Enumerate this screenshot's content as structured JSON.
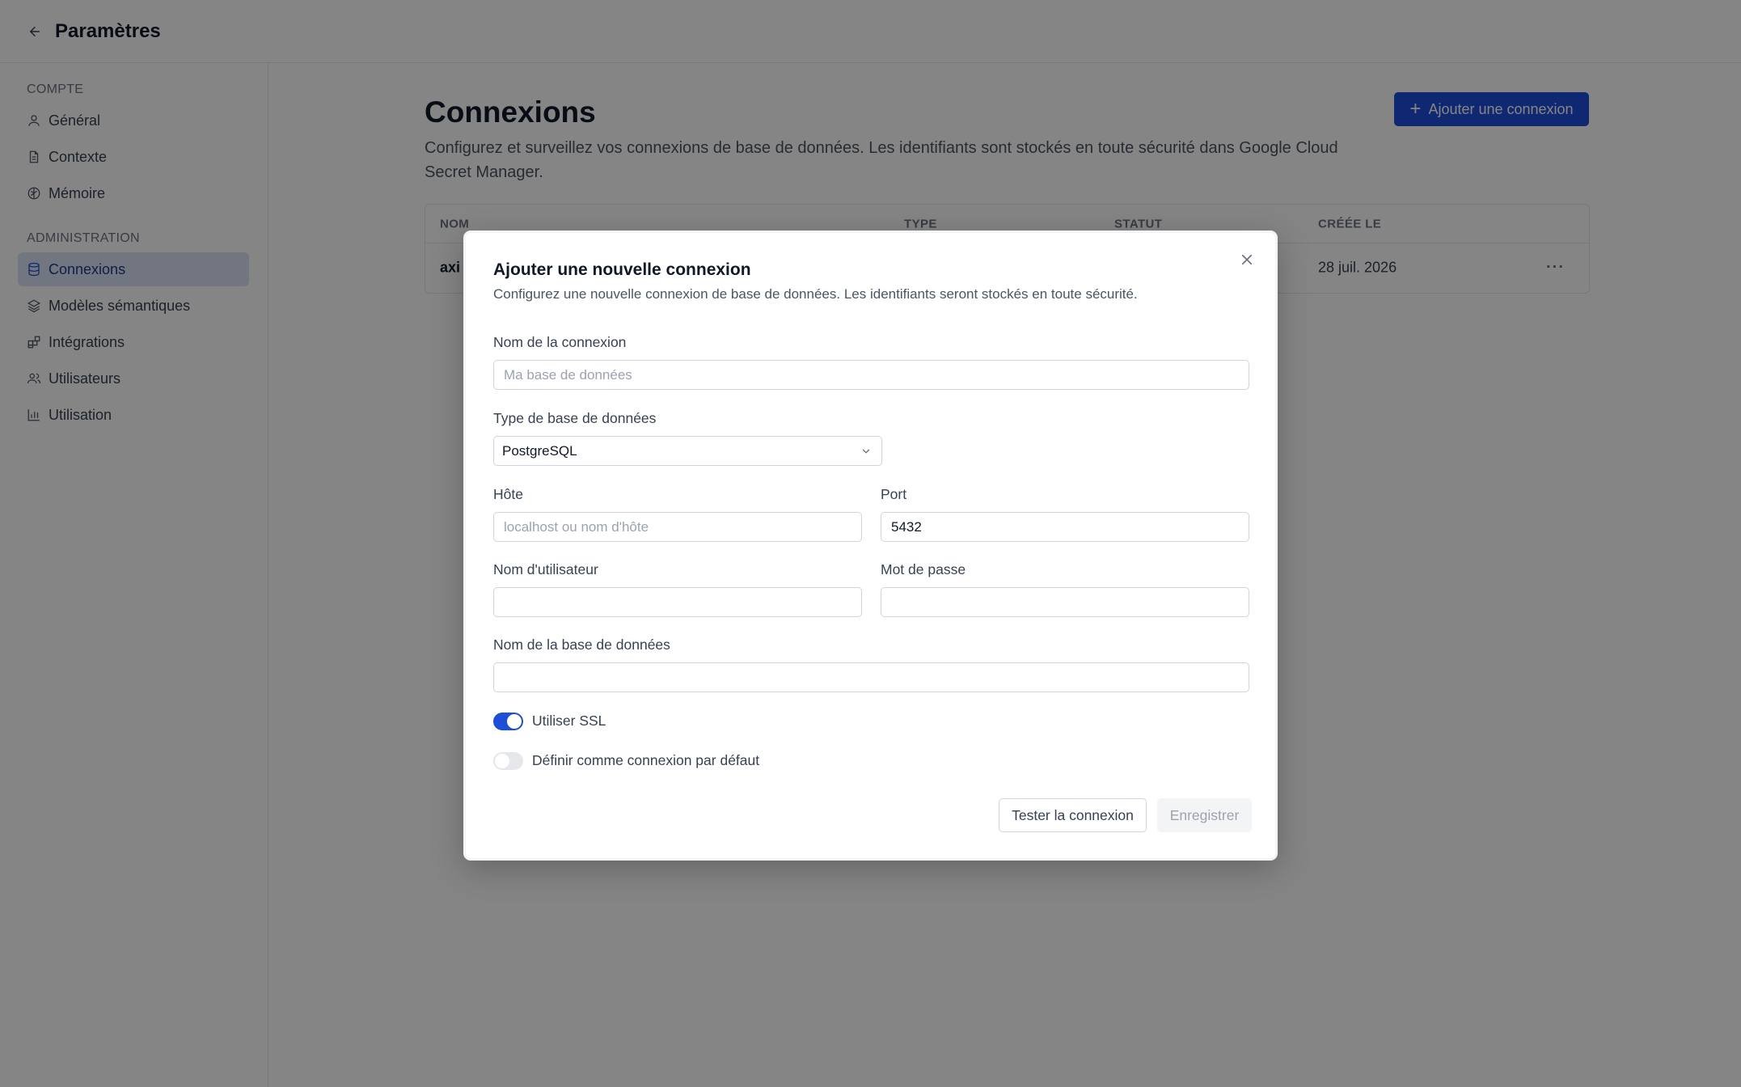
{
  "header": {
    "title": "Paramètres"
  },
  "sidebar": {
    "section_account": "COMPTE",
    "section_admin": "ADMINISTRATION",
    "items": [
      {
        "label": "Général",
        "icon": "user-icon"
      },
      {
        "label": "Contexte",
        "icon": "document-icon"
      },
      {
        "label": "Mémoire",
        "icon": "brain-icon"
      },
      {
        "label": "Connexions",
        "icon": "database-icon",
        "active": true
      },
      {
        "label": "Modèles sémantiques",
        "icon": "layers-icon"
      },
      {
        "label": "Intégrations",
        "icon": "blocks-icon"
      },
      {
        "label": "Utilisateurs",
        "icon": "users-icon"
      },
      {
        "label": "Utilisation",
        "icon": "bar-chart-icon"
      }
    ]
  },
  "main": {
    "title": "Connexions",
    "description": "Configurez et surveillez vos connexions de base de données. Les identifiants sont stockés en toute sécurité dans Google Cloud Secret Manager.",
    "add_button": "Ajouter une connexion",
    "table": {
      "headers": [
        "NOM",
        "TYPE",
        "STATUT",
        "CRÉÉE LE"
      ],
      "rows": [
        {
          "name": "axi",
          "created": "28 juil. 2026",
          "actions": "···"
        }
      ]
    }
  },
  "modal": {
    "title": "Ajouter une nouvelle connexion",
    "description": "Configurez une nouvelle connexion de base de données. Les identifiants seront stockés en toute sécurité.",
    "fields": {
      "name_label": "Nom de la connexion",
      "name_placeholder": "Ma base de données",
      "name_value": "",
      "type_label": "Type de base de données",
      "type_value": "PostgreSQL",
      "host_label": "Hôte",
      "host_placeholder": "localhost ou nom d'hôte",
      "port_label": "Port",
      "port_value": "5432",
      "user_label": "Nom d'utilisateur",
      "password_label": "Mot de passe",
      "dbname_label": "Nom de la base de données"
    },
    "toggles": {
      "ssl_label": "Utiliser SSL",
      "ssl_on": true,
      "default_label": "Définir comme connexion par défaut",
      "default_on": false
    },
    "buttons": {
      "test": "Tester la connexion",
      "save": "Enregistrer"
    }
  },
  "colors": {
    "accent": "#1d4ed8",
    "overlay": "rgba(0,0,0,0.48)"
  }
}
